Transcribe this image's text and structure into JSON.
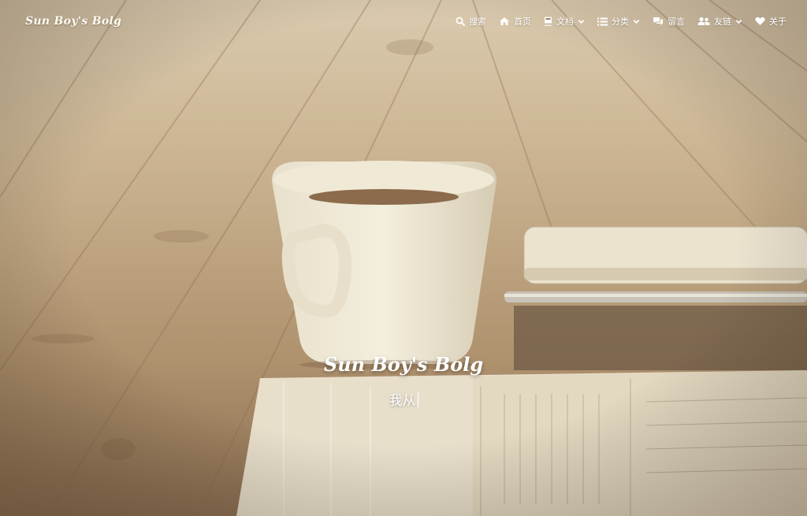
{
  "site": {
    "brand": "Sun Boy's Bolg"
  },
  "nav": {
    "items": [
      {
        "label": "搜索",
        "icon": "search-icon"
      },
      {
        "label": "首页",
        "icon": "home-icon"
      },
      {
        "label": "文档",
        "icon": "book-icon",
        "dropdown": true
      },
      {
        "label": "分类",
        "icon": "list-icon",
        "dropdown": true
      },
      {
        "label": "留言",
        "icon": "comments-icon"
      },
      {
        "label": "友链",
        "icon": "users-icon",
        "dropdown": true
      },
      {
        "label": "关于",
        "icon": "heart-icon"
      }
    ]
  },
  "hero": {
    "title": "Sun Boy's Bolg",
    "subtitle": "我从"
  },
  "colors": {
    "text": "#ffffff",
    "background_tone": "#c6ad8a"
  }
}
